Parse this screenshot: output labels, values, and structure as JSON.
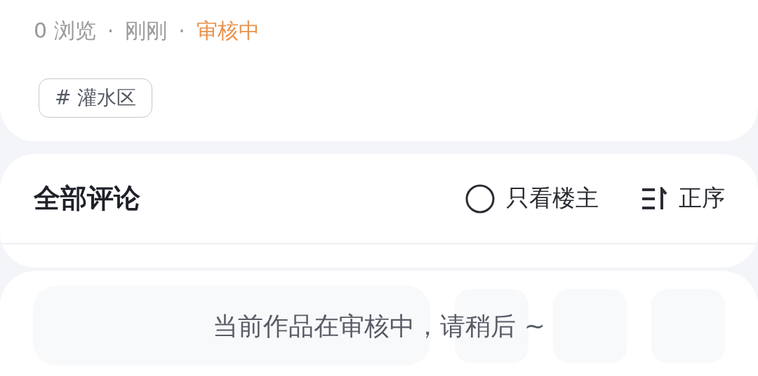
{
  "post_meta": {
    "views": "0 浏览",
    "separators": [
      "·",
      "·"
    ],
    "time": "刚刚",
    "status": "审核中"
  },
  "tags": [
    "# 灌水区"
  ],
  "comments": {
    "title": "全部评论",
    "filters": [
      {
        "kind": "radio",
        "label": "只看楼主",
        "checked": false
      },
      {
        "kind": "sort",
        "label": "正序"
      }
    ]
  },
  "comment_bar": {
    "notice": "当前作品在审核中，请稍后 ~"
  }
}
